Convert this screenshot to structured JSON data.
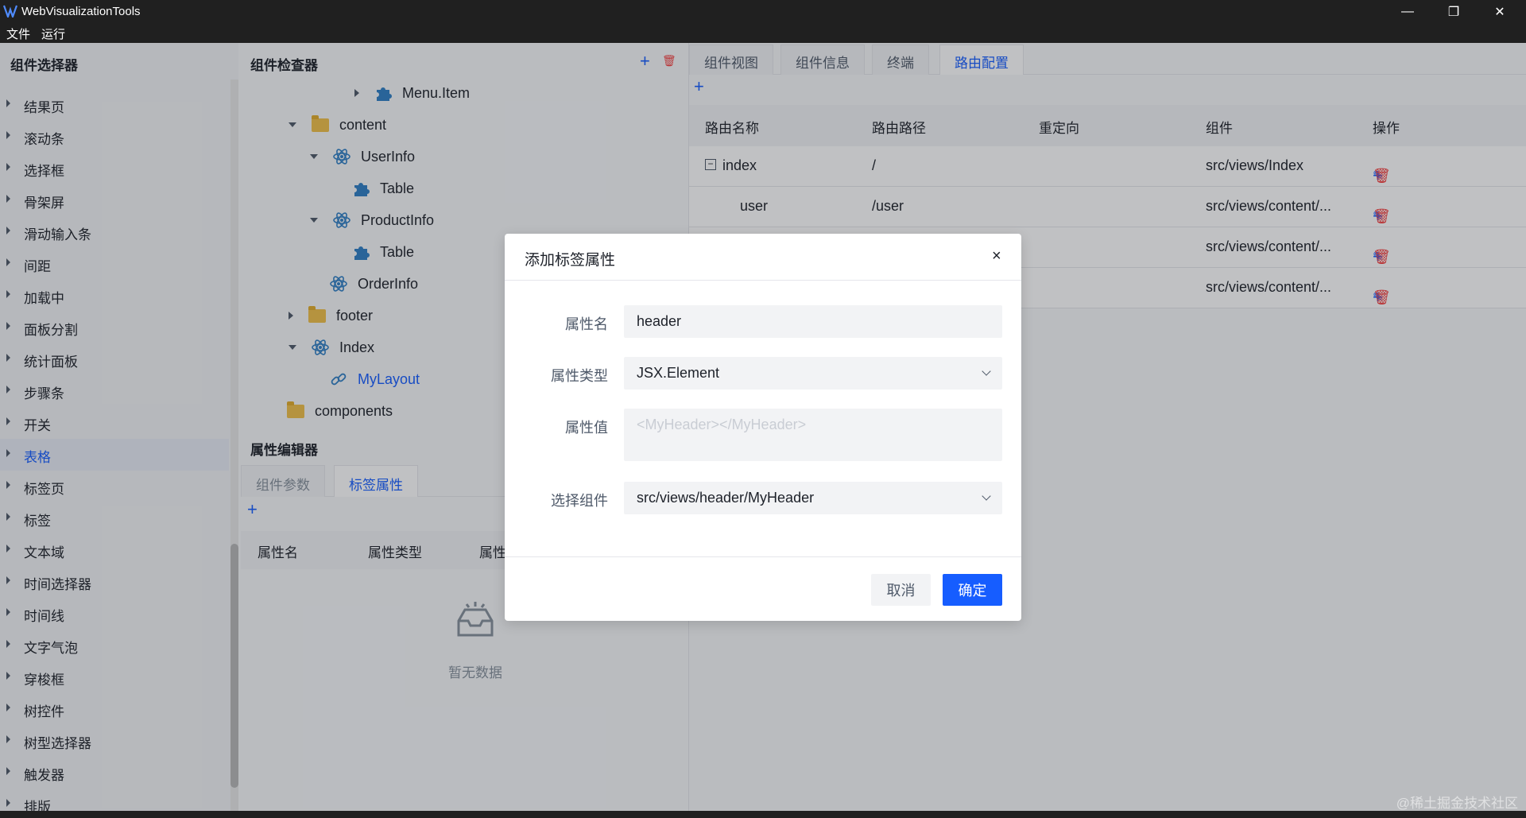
{
  "window": {
    "title": "WebVisualizationTools",
    "minimize": "—",
    "restore": "❐",
    "close": "✕"
  },
  "menu": {
    "file": "文件",
    "run": "运行"
  },
  "component_selector": {
    "title": "组件选择器",
    "items": [
      "结果页",
      "滚动条",
      "选择框",
      "骨架屏",
      "滑动输入条",
      "间距",
      "加载中",
      "面板分割",
      "统计面板",
      "步骤条",
      "开关",
      "表格",
      "标签页",
      "标签",
      "文本域",
      "时间选择器",
      "时间线",
      "文字气泡",
      "穿梭框",
      "树控件",
      "树型选择器",
      "触发器",
      "排版"
    ],
    "active_item": "表格"
  },
  "component_inspector": {
    "title": "组件检查器",
    "add": "+",
    "delete": "🗑",
    "tree": [
      {
        "label": "Menu.Item"
      },
      {
        "label": "content"
      },
      {
        "label": "UserInfo"
      },
      {
        "label": "Table"
      },
      {
        "label": "ProductInfo"
      },
      {
        "label": "Table"
      },
      {
        "label": "OrderInfo"
      },
      {
        "label": "footer"
      },
      {
        "label": "Index"
      },
      {
        "label": "MyLayout"
      },
      {
        "label": "components"
      }
    ]
  },
  "property_editor": {
    "title": "属性编辑器",
    "tabs": [
      "组件参数",
      "标签属性"
    ],
    "add": "+",
    "columns": [
      "属性名",
      "属性类型",
      "属性"
    ],
    "empty_text": "暂无数据"
  },
  "main_panel": {
    "tabs": [
      "组件视图",
      "组件信息",
      "终端",
      "路由配置"
    ],
    "active_tab": "路由配置",
    "add": "+",
    "columns": [
      "路由名称",
      "路由路径",
      "重定向",
      "组件",
      "操作"
    ],
    "rows": [
      {
        "name": "index",
        "path": "/",
        "redirect": "",
        "component": "src/views/Index",
        "collapse": "−"
      },
      {
        "name": "user",
        "path": "/user",
        "redirect": "",
        "component": "src/views/content/..."
      },
      {
        "name": "",
        "path": "",
        "redirect": "",
        "component": "src/views/content/..."
      },
      {
        "name": "",
        "path": "",
        "redirect": "",
        "component": "src/views/content/..."
      }
    ],
    "op_add": "+",
    "op_edit": "✎",
    "op_delete": "🗑"
  },
  "dialog": {
    "title": "添加标签属性",
    "close": "×",
    "fields": {
      "name_label": "属性名",
      "name_value": "header",
      "type_label": "属性类型",
      "type_value": "JSX.Element",
      "value_label": "属性值",
      "value_placeholder": "<MyHeader></MyHeader>",
      "component_label": "选择组件",
      "component_value": "src/views/header/MyHeader"
    },
    "cancel": "取消",
    "ok": "确定"
  },
  "watermark": "@稀土掘金技术社区",
  "colors": {
    "accent": "#165dff",
    "danger": "#f53f3f",
    "titlebar": "#202020"
  }
}
